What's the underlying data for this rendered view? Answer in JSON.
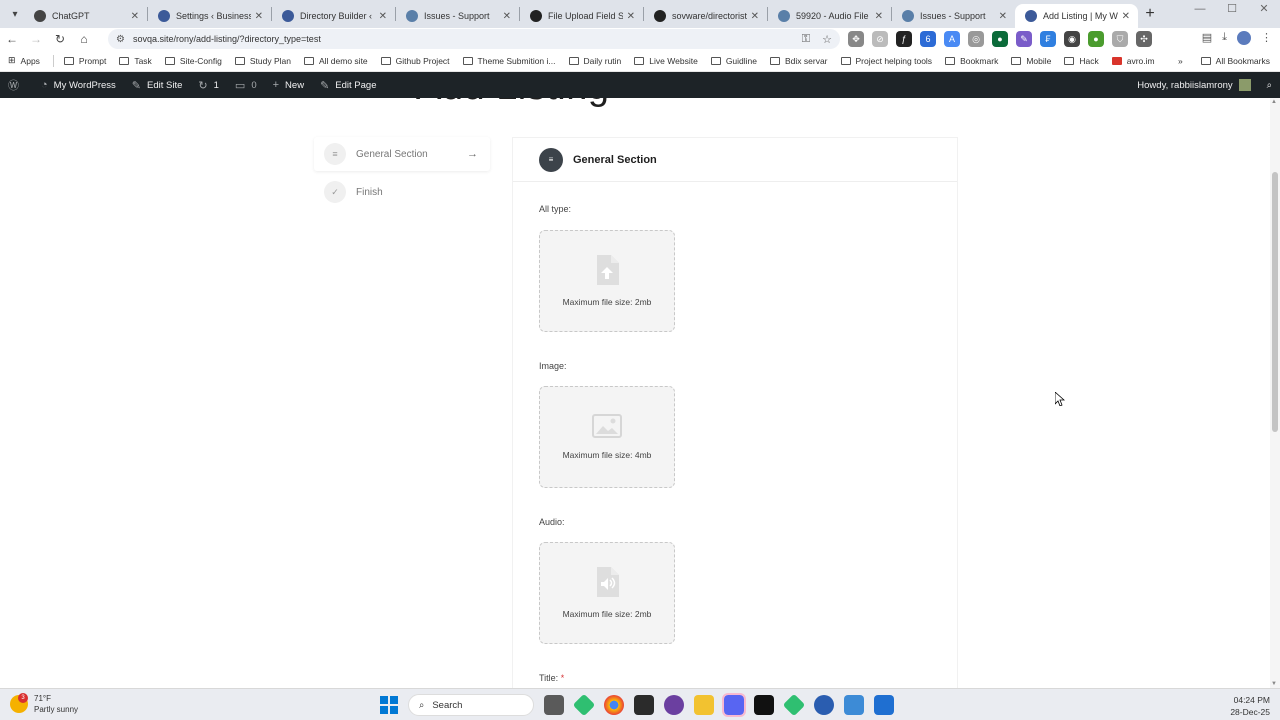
{
  "browser": {
    "tabs": [
      {
        "title": "ChatGPT",
        "favicon_color": "#444444",
        "active": false
      },
      {
        "title": "Settings ‹ Business Si",
        "favicon_color": "#3c5a99",
        "active": false
      },
      {
        "title": "Directory Builder ‹ Bu",
        "favicon_color": "#3c5a99",
        "active": false
      },
      {
        "title": "Issues - Support",
        "favicon_color": "#5a7fa8",
        "active": false
      },
      {
        "title": "File Upload Field S",
        "favicon_color": "#222222",
        "active": false
      },
      {
        "title": "sovware/directorist: I",
        "favicon_color": "#222222",
        "active": false
      },
      {
        "title": "59920 - Audio File Ic",
        "favicon_color": "#5a7fa8",
        "active": false
      },
      {
        "title": "Issues - Support",
        "favicon_color": "#5a7fa8",
        "active": false
      },
      {
        "title": "Add Listing | My Wo",
        "favicon_color": "#3c5a99",
        "active": true
      }
    ],
    "url": "sovqa.site/rony/add-listing/?directory_type=test",
    "bookmarks": [
      "Apps",
      "Prompt",
      "Task",
      "Site-Config",
      "Study Plan",
      "All demo site",
      "Github Project",
      "Theme Submition i...",
      "Daily rutin",
      "Live Website",
      "Guidline",
      "Bdix servar",
      "Project helping tools",
      "Bookmark",
      "Mobile",
      "Hack",
      "avro.im"
    ],
    "all_bookmarks": "All Bookmarks"
  },
  "wp_admin_bar": {
    "site_name": "My WordPress",
    "edit_site": "Edit Site",
    "updates_count": "1",
    "comments_count": "0",
    "new_label": "New",
    "edit_page": "Edit Page",
    "howdy": "Howdy, rabbiislamrony"
  },
  "page": {
    "ghost_title": "Add Listing",
    "sidebar": [
      {
        "label": "General Section",
        "icon": "list-icon",
        "active": true
      },
      {
        "label": "Finish",
        "icon": "check-icon",
        "active": false
      }
    ],
    "section_title": "General Section",
    "fields": [
      {
        "label": "All type:",
        "hint": "Maximum file size: 2mb",
        "icon": "upload-file-icon"
      },
      {
        "label": "Image:",
        "hint": "Maximum file size: 4mb",
        "icon": "image-icon"
      },
      {
        "label": "Audio:",
        "hint": "Maximum file size: 2mb",
        "icon": "audio-file-icon"
      }
    ],
    "title_label": "Title:",
    "required_mark": "*"
  },
  "taskbar": {
    "temperature": "71°F",
    "weather": "Partly sunny",
    "weather_badge": "3",
    "search_placeholder": "Search",
    "time": "04:24 PM",
    "date": "28-Dec-25"
  }
}
